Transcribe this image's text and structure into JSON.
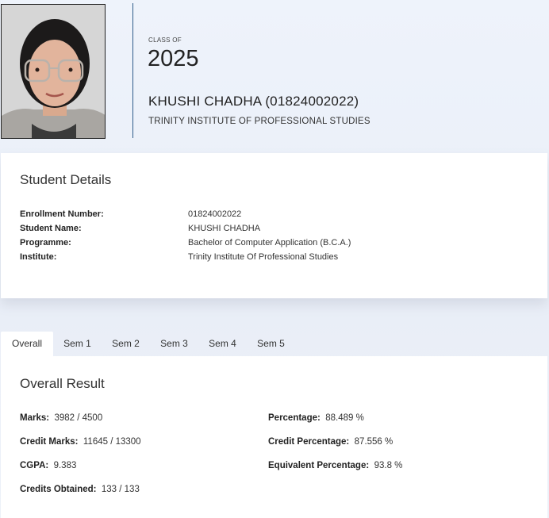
{
  "header": {
    "class_of_label": "CLASS OF",
    "year": "2025",
    "student_title": "KHUSHI CHADHA (01824002022)",
    "institute": "TRINITY INSTITUTE OF PROFESSIONAL STUDIES"
  },
  "details": {
    "title": "Student Details",
    "rows": [
      {
        "label": "Enrollment Number:",
        "value": "01824002022"
      },
      {
        "label": "Student Name:",
        "value": "KHUSHI CHADHA"
      },
      {
        "label": "Programme:",
        "value": "Bachelor of Computer Application (B.C.A.)"
      },
      {
        "label": "Institute:",
        "value": "Trinity Institute Of Professional Studies"
      }
    ]
  },
  "tabs": [
    {
      "label": "Overall",
      "active": true
    },
    {
      "label": "Sem 1"
    },
    {
      "label": "Sem 2"
    },
    {
      "label": "Sem 3"
    },
    {
      "label": "Sem 4"
    },
    {
      "label": "Sem 5"
    }
  ],
  "result": {
    "title": "Overall Result",
    "marks": {
      "label": "Marks:",
      "value": "3982 / 4500"
    },
    "credit_marks": {
      "label": "Credit Marks:",
      "value": "11645 / 13300"
    },
    "cgpa": {
      "label": "CGPA:",
      "value": "9.383"
    },
    "credits_obtained": {
      "label": "Credits Obtained:",
      "value": "133 / 133"
    },
    "percentage": {
      "label": "Percentage:",
      "value": "88.489 %"
    },
    "credit_percentage": {
      "label": "Credit Percentage:",
      "value": "87.556 %"
    },
    "equivalent_percentage": {
      "label": "Equivalent Percentage:",
      "value": "93.8 %"
    }
  },
  "colors": {
    "accent_line": "#2f5c8a",
    "page_bg": "#eef3fb"
  }
}
